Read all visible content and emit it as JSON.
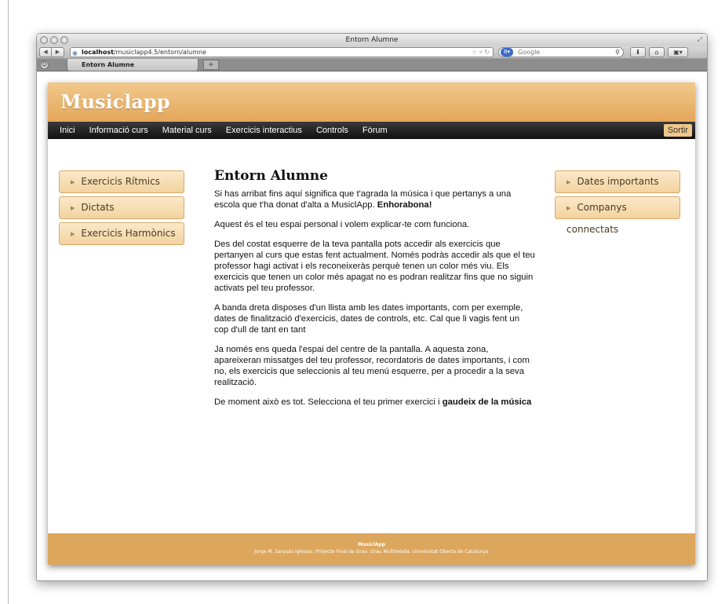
{
  "browser": {
    "title": "Entorn Alumne",
    "url_host": "localhost",
    "url_path": "/musiclapp4.5/entorn/alumne",
    "search_placeholder": "Google",
    "tab_title": "Entorn Alumne",
    "new_tab": "+"
  },
  "site": {
    "logo": "Musiclapp",
    "menu": [
      "Inici",
      "Informació curs",
      "Material curs",
      "Exercicis interactius",
      "Controls",
      "Fòrum"
    ],
    "logout": "Sortir",
    "left_nav": [
      "Exercicis Rítmics",
      "Dictats",
      "Exercicis Harmònics"
    ],
    "right_nav": [
      "Dates importants",
      "Companys connectats"
    ]
  },
  "main": {
    "title": "Entorn Alumne",
    "p1": "Si has arribat fins aquí significa que t'agrada la música i que pertanys a una escola que t'ha donat d'alta a MusiclApp. ",
    "p1_bold": "Enhorabona!",
    "p2": "Aquest és el teu espai personal i volem explicar-te com funciona.",
    "p3": "Des del costat esquerre de la teva pantalla pots accedir als exercicis que pertanyen al curs que estas fent actualment. Només podràs accedir als que el teu professor hagi activat i els reconeixeràs perquè tenen un color més viu. Els exercicis que tenen un color més apagat no es podran realitzar fins que no siguin activats pel teu professor.",
    "p4": "A banda dreta disposes d'un llista amb les dates importants, com per exemple, dates de finalització d'exercicis, dates de controls, etc. Cal que li vagis fent un cop d'ull de tant en tant",
    "p5": "Ja només ens queda l'espai del centre de la pantalla. A aquesta zona, apareixeran missatges del teu professor, recordatoris de dates importants, i com no, els exercicis que seleccionis al teu menú esquerre, per a procedir a la seva realització.",
    "p6": "De moment això es tot. Selecciona el teu primer exercici i ",
    "p6_bold": "gaudeix de la música"
  },
  "footer": {
    "name": "MusiclApp",
    "credit": "Jorge M. Sanjuás Iglesias. Projecte Final de Grau. Grau Multimèdia. Universitat Oberta de Catalunya"
  }
}
